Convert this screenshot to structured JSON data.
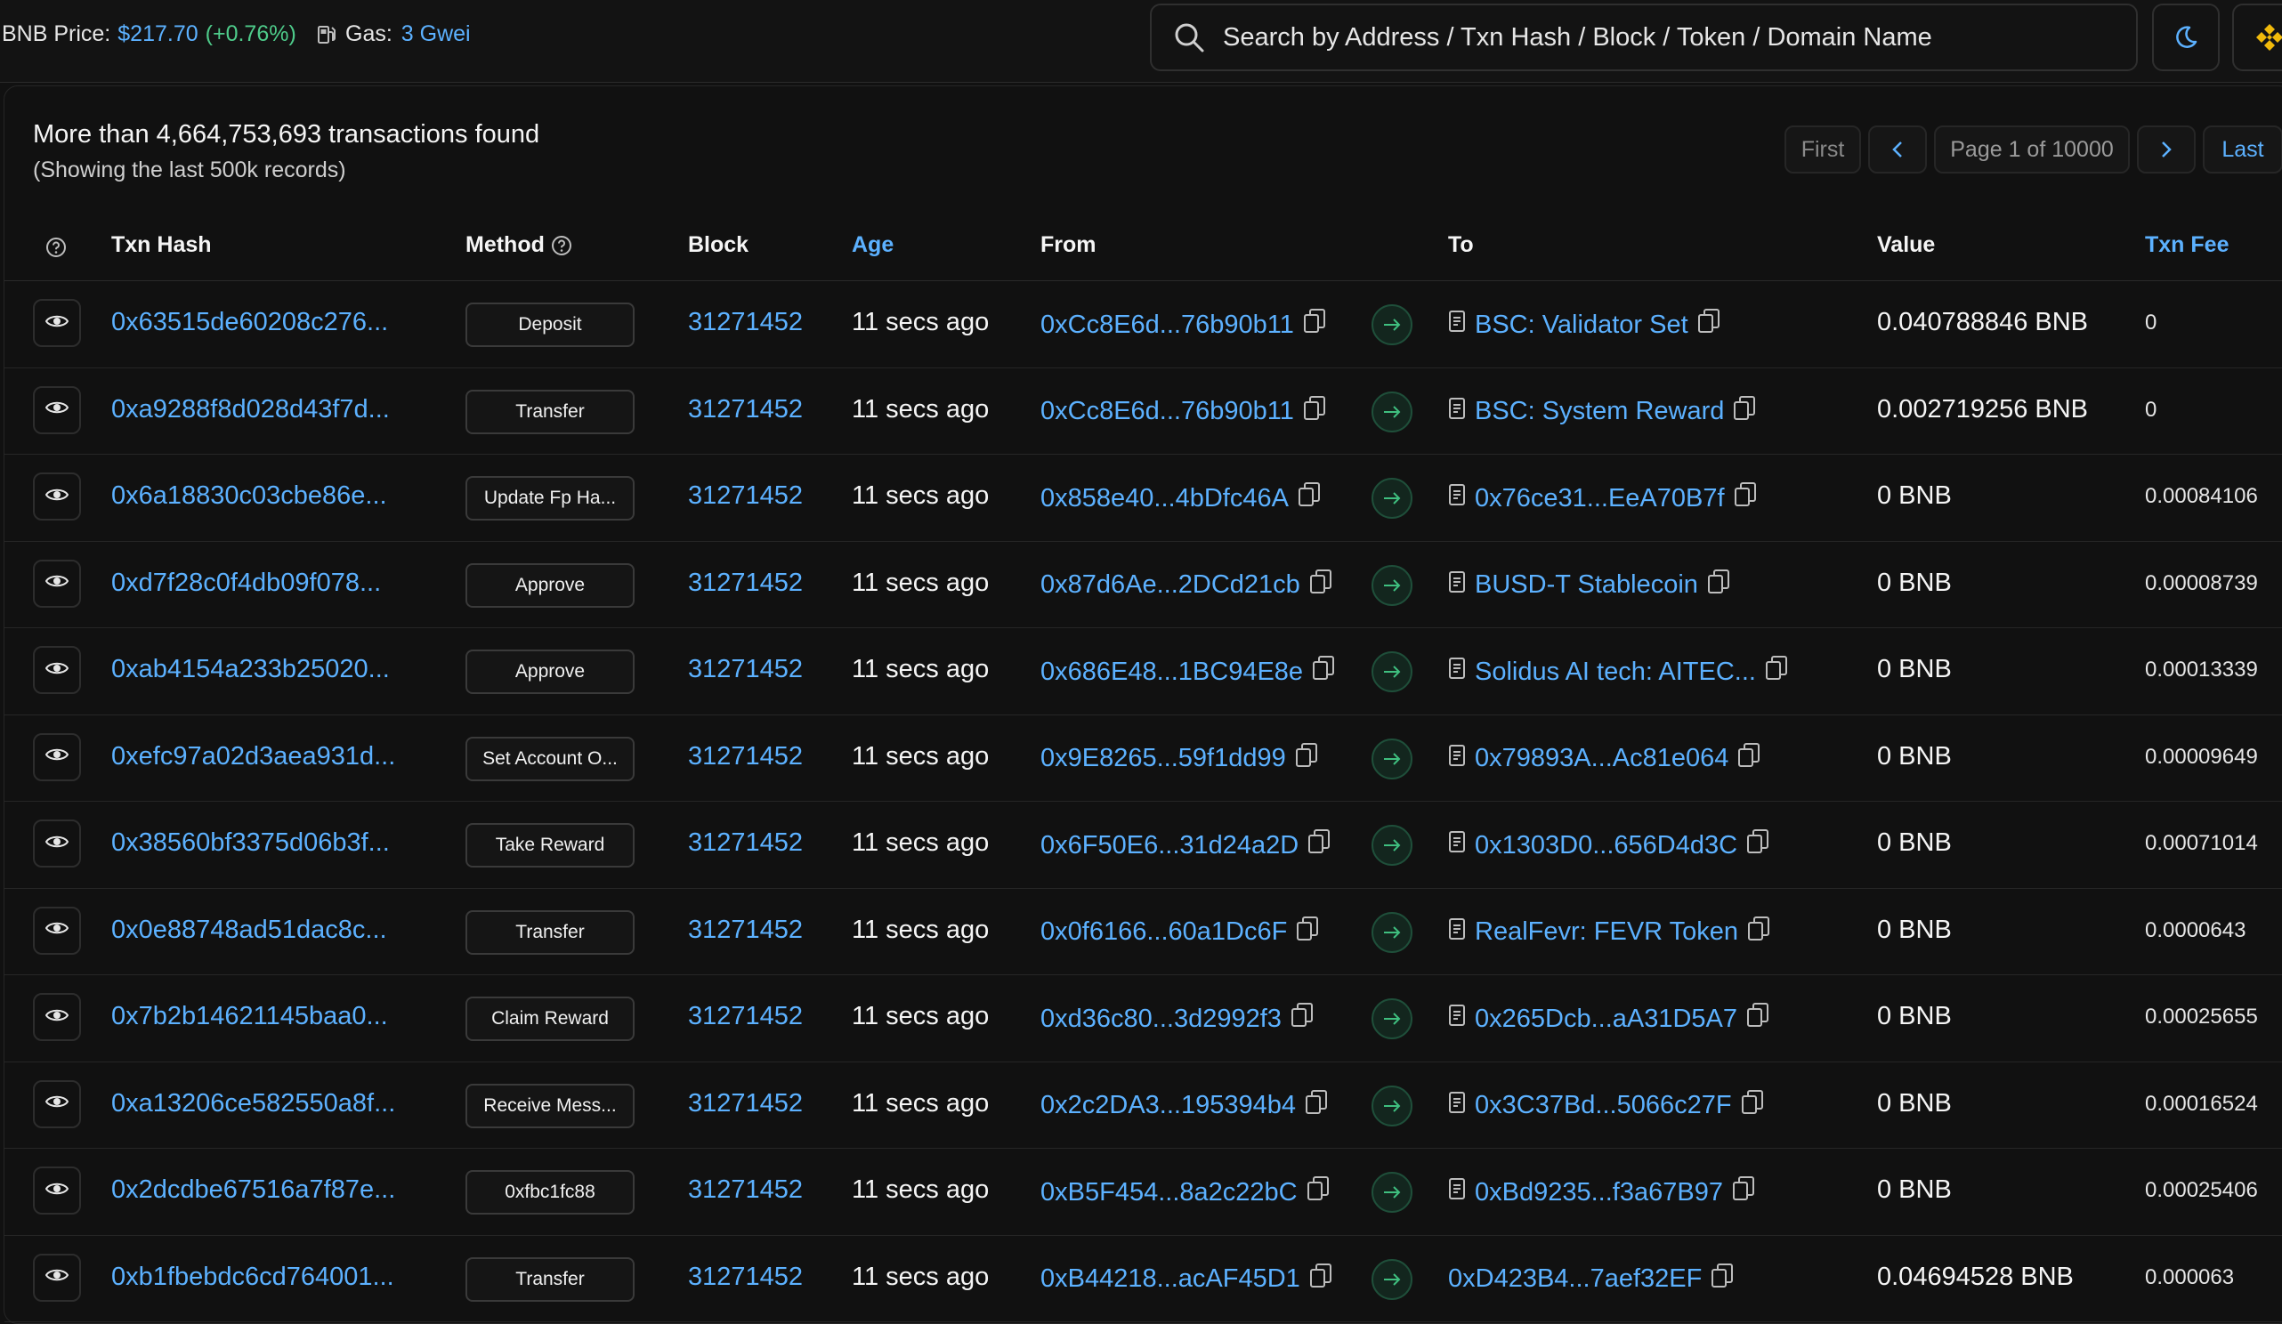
{
  "topbar": {
    "bnb_price_label": "BNB Price:",
    "bnb_price_value": "$217.70",
    "bnb_price_change": "(+0.76%)",
    "gas_label": "Gas:",
    "gas_value": "3 Gwei",
    "search_placeholder": "Search by Address / Txn Hash / Block / Token / Domain Name"
  },
  "summary": {
    "found_text": "More than 4,664,753,693 transactions found",
    "sub_text": "(Showing the last 500k records)"
  },
  "pager": {
    "first": "First",
    "prev": "<",
    "page": "Page 1 of 10000",
    "next": ">",
    "last": "Last"
  },
  "columns": {
    "txn_hash": "Txn Hash",
    "method": "Method",
    "block": "Block",
    "age": "Age",
    "from": "From",
    "to": "To",
    "value": "Value",
    "txn_fee": "Txn Fee"
  },
  "rows": [
    {
      "hash": "0x63515de60208c276...",
      "method": "Deposit",
      "block": "31271452",
      "age": "11 secs ago",
      "from": "0xCc8E6d...76b90b11",
      "to": "BSC: Validator Set",
      "to_contract": true,
      "value": "0.040788846 BNB",
      "fee": "0"
    },
    {
      "hash": "0xa9288f8d028d43f7d...",
      "method": "Transfer",
      "block": "31271452",
      "age": "11 secs ago",
      "from": "0xCc8E6d...76b90b11",
      "to": "BSC: System Reward",
      "to_contract": true,
      "value": "0.002719256 BNB",
      "fee": "0"
    },
    {
      "hash": "0x6a18830c03cbe86e...",
      "method": "Update Fp Ha...",
      "block": "31271452",
      "age": "11 secs ago",
      "from": "0x858e40...4bDfc46A",
      "to": "0x76ce31...EeA70B7f",
      "to_contract": true,
      "value": "0 BNB",
      "fee": "0.00084106"
    },
    {
      "hash": "0xd7f28c0f4db09f078...",
      "method": "Approve",
      "block": "31271452",
      "age": "11 secs ago",
      "from": "0x87d6Ae...2DCd21cb",
      "to": "BUSD-T Stablecoin",
      "to_contract": true,
      "value": "0 BNB",
      "fee": "0.00008739"
    },
    {
      "hash": "0xab4154a233b25020...",
      "method": "Approve",
      "block": "31271452",
      "age": "11 secs ago",
      "from": "0x686E48...1BC94E8e",
      "to": "Solidus AI tech: AITEC...",
      "to_contract": true,
      "value": "0 BNB",
      "fee": "0.00013339"
    },
    {
      "hash": "0xefc97a02d3aea931d...",
      "method": "Set Account O...",
      "block": "31271452",
      "age": "11 secs ago",
      "from": "0x9E8265...59f1dd99",
      "to": "0x79893A...Ac81e064",
      "to_contract": true,
      "value": "0 BNB",
      "fee": "0.00009649"
    },
    {
      "hash": "0x38560bf3375d06b3f...",
      "method": "Take Reward",
      "block": "31271452",
      "age": "11 secs ago",
      "from": "0x6F50E6...31d24a2D",
      "to": "0x1303D0...656D4d3C",
      "to_contract": true,
      "value": "0 BNB",
      "fee": "0.00071014"
    },
    {
      "hash": "0x0e88748ad51dac8c...",
      "method": "Transfer",
      "block": "31271452",
      "age": "11 secs ago",
      "from": "0x0f6166...60a1Dc6F",
      "to": "RealFevr: FEVR Token",
      "to_contract": true,
      "value": "0 BNB",
      "fee": "0.0000643"
    },
    {
      "hash": "0x7b2b14621145baa0...",
      "method": "Claim Reward",
      "block": "31271452",
      "age": "11 secs ago",
      "from": "0xd36c80...3d2992f3",
      "to": "0x265Dcb...aA31D5A7",
      "to_contract": true,
      "value": "0 BNB",
      "fee": "0.00025655"
    },
    {
      "hash": "0xa13206ce582550a8f...",
      "method": "Receive Mess...",
      "block": "31271452",
      "age": "11 secs ago",
      "from": "0x2c2DA3...195394b4",
      "to": "0x3C37Bd...5066c27F",
      "to_contract": true,
      "value": "0 BNB",
      "fee": "0.00016524"
    },
    {
      "hash": "0x2dcdbe67516a7f87e...",
      "method": "0xfbc1fc88",
      "block": "31271452",
      "age": "11 secs ago",
      "from": "0xB5F454...8a2c22bC",
      "to": "0xBd9235...f3a67B97",
      "to_contract": true,
      "value": "0 BNB",
      "fee": "0.00025406"
    },
    {
      "hash": "0xb1fbebdc6cd764001...",
      "method": "Transfer",
      "block": "31271452",
      "age": "11 secs ago",
      "from": "0xB44218...acAF45D1",
      "to": "0xD423B4...7aef32EF",
      "to_contract": false,
      "value": "0.04694528 BNB",
      "fee": "0.000063"
    }
  ],
  "colors": {
    "accent": "#5cb1ff",
    "positive": "#4ecb8a",
    "background": "#111111"
  }
}
